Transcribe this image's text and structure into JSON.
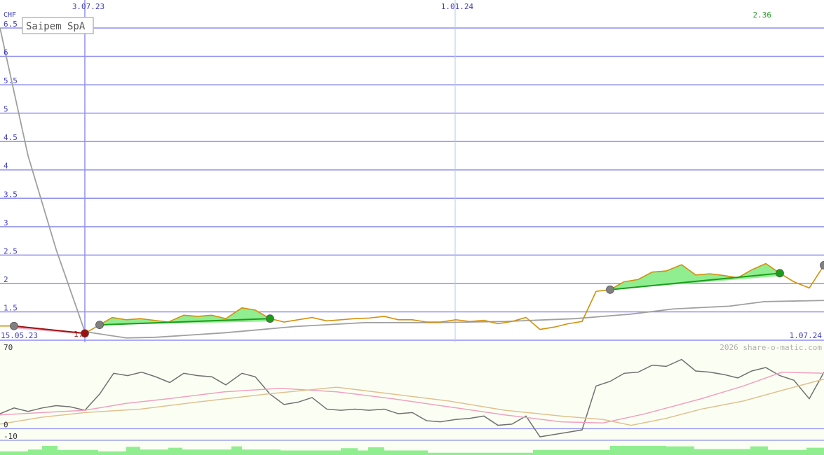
{
  "chart_data": {
    "type": "line",
    "title": "Saipem SpA",
    "ylabel": "CHF",
    "watermark": "2026 share-o-matic.com",
    "ylim": [
      1.0,
      6.5
    ],
    "y_ticks": [
      "6.5",
      "6",
      "5.5",
      "5",
      "4.5",
      "4",
      "3.5",
      "3",
      "2.5",
      "2",
      "1.5"
    ],
    "x_top_labels": [
      "3.07.23",
      "1.01.24"
    ],
    "x_corner_labels": {
      "start": "15.05.23",
      "end": "1.07.24"
    },
    "last_value_label": "2.36",
    "low_value_label": "1.",
    "indicator_ticks": [
      "70",
      "0",
      "-10"
    ],
    "indicator_ylim": [
      -10,
      70
    ],
    "colors": {
      "price": "#d4900a",
      "moving_avg": "#a0a0a0",
      "trend_up": "#1a9e1a",
      "trend_down": "#a01010",
      "fill_up": "#90ee90",
      "fill_down": "#f4b0c8",
      "grid": "#8f8ff0",
      "osc": "#707070",
      "osc_pink": "#f0a0c0",
      "osc_tan": "#e0c090"
    },
    "series": [
      {
        "key": "price",
        "values": [
          [
            0,
            1.25
          ],
          [
            20,
            1.25
          ],
          [
            121,
            1.12
          ],
          [
            142,
            1.27
          ],
          [
            160,
            1.4
          ],
          [
            180,
            1.36
          ],
          [
            200,
            1.38
          ],
          [
            220,
            1.35
          ],
          [
            240,
            1.32
          ],
          [
            262,
            1.44
          ],
          [
            282,
            1.42
          ],
          [
            302,
            1.44
          ],
          [
            322,
            1.38
          ],
          [
            345,
            1.57
          ],
          [
            364,
            1.53
          ],
          [
            385,
            1.38
          ],
          [
            405,
            1.32
          ],
          [
            425,
            1.36
          ],
          [
            445,
            1.4
          ],
          [
            466,
            1.34
          ],
          [
            486,
            1.36
          ],
          [
            506,
            1.38
          ],
          [
            526,
            1.39
          ],
          [
            548,
            1.42
          ],
          [
            568,
            1.36
          ],
          [
            588,
            1.36
          ],
          [
            608,
            1.32
          ],
          [
            628,
            1.32
          ],
          [
            650,
            1.36
          ],
          [
            670,
            1.33
          ],
          [
            690,
            1.35
          ],
          [
            710,
            1.29
          ],
          [
            730,
            1.33
          ],
          [
            750,
            1.4
          ],
          [
            770,
            1.19
          ],
          [
            790,
            1.23
          ],
          [
            810,
            1.29
          ],
          [
            830,
            1.33
          ],
          [
            850,
            1.86
          ],
          [
            870,
            1.89
          ],
          [
            890,
            2.03
          ],
          [
            910,
            2.07
          ],
          [
            930,
            2.2
          ],
          [
            950,
            2.22
          ],
          [
            972,
            2.33
          ],
          [
            992,
            2.15
          ],
          [
            1012,
            2.17
          ],
          [
            1032,
            2.14
          ],
          [
            1052,
            2.1
          ],
          [
            1072,
            2.24
          ],
          [
            1092,
            2.35
          ],
          [
            1112,
            2.18
          ],
          [
            1132,
            2.03
          ],
          [
            1154,
            1.92
          ],
          [
            1175,
            2.32
          ]
        ]
      },
      {
        "key": "moving_avg",
        "values": [
          [
            0,
            6.5
          ],
          [
            40,
            4.25
          ],
          [
            80,
            2.6
          ],
          [
            121,
            1.15
          ],
          [
            180,
            1.04
          ],
          [
            220,
            1.05
          ],
          [
            320,
            1.13
          ],
          [
            420,
            1.24
          ],
          [
            520,
            1.31
          ],
          [
            620,
            1.31
          ],
          [
            720,
            1.33
          ],
          [
            820,
            1.38
          ],
          [
            900,
            1.46
          ],
          [
            960,
            1.55
          ],
          [
            1040,
            1.6
          ],
          [
            1090,
            1.68
          ],
          [
            1175,
            1.7
          ]
        ]
      }
    ],
    "trend_segments": [
      {
        "direction": "down",
        "from": [
          20,
          1.25
        ],
        "to": [
          121,
          1.12
        ]
      },
      {
        "direction": "up",
        "from": [
          142,
          1.27
        ],
        "to": [
          385,
          1.38
        ]
      },
      {
        "direction": "up",
        "from": [
          870,
          1.89
        ],
        "to": [
          1112,
          2.18
        ]
      }
    ],
    "markers": [
      {
        "x": 20,
        "y": 1.25,
        "color": "#808080"
      },
      {
        "x": 121,
        "y": 1.12,
        "color": "#a01010"
      },
      {
        "x": 142,
        "y": 1.27,
        "color": "#808080"
      },
      {
        "x": 385,
        "y": 1.38,
        "color": "#1a9e1a"
      },
      {
        "x": 870,
        "y": 1.89,
        "color": "#808080"
      },
      {
        "x": 1112,
        "y": 2.18,
        "color": "#1a9e1a"
      },
      {
        "x": 1175,
        "y": 2.32,
        "color": "#808080"
      }
    ],
    "indicator_series": [
      {
        "key": "osc",
        "values": [
          [
            0,
            13
          ],
          [
            20,
            18
          ],
          [
            40,
            15
          ],
          [
            60,
            18
          ],
          [
            80,
            20
          ],
          [
            100,
            19
          ],
          [
            121,
            16
          ],
          [
            142,
            30
          ],
          [
            162,
            48
          ],
          [
            182,
            46
          ],
          [
            202,
            49
          ],
          [
            222,
            45
          ],
          [
            242,
            40
          ],
          [
            262,
            48
          ],
          [
            282,
            46
          ],
          [
            302,
            45
          ],
          [
            322,
            38
          ],
          [
            345,
            48
          ],
          [
            364,
            45
          ],
          [
            385,
            30
          ],
          [
            405,
            21
          ],
          [
            425,
            23
          ],
          [
            445,
            27
          ],
          [
            466,
            17
          ],
          [
            486,
            16
          ],
          [
            506,
            17
          ],
          [
            526,
            16
          ],
          [
            548,
            17
          ],
          [
            568,
            13
          ],
          [
            588,
            14
          ],
          [
            608,
            7
          ],
          [
            628,
            6
          ],
          [
            650,
            8
          ],
          [
            670,
            9
          ],
          [
            690,
            11
          ],
          [
            710,
            3
          ],
          [
            730,
            4
          ],
          [
            750,
            11
          ],
          [
            770,
            -7
          ],
          [
            790,
            -5
          ],
          [
            810,
            -3
          ],
          [
            830,
            -1
          ],
          [
            850,
            37
          ],
          [
            870,
            41
          ],
          [
            890,
            48
          ],
          [
            910,
            49
          ],
          [
            930,
            55
          ],
          [
            950,
            54
          ],
          [
            972,
            60
          ],
          [
            992,
            50
          ],
          [
            1012,
            49
          ],
          [
            1032,
            47
          ],
          [
            1052,
            44
          ],
          [
            1072,
            50
          ],
          [
            1092,
            53
          ],
          [
            1112,
            46
          ],
          [
            1132,
            42
          ],
          [
            1154,
            26
          ],
          [
            1175,
            49
          ]
        ]
      },
      {
        "key": "osc_pink",
        "values": [
          [
            0,
            12
          ],
          [
            60,
            14
          ],
          [
            121,
            16
          ],
          [
            180,
            22
          ],
          [
            240,
            26
          ],
          [
            320,
            32
          ],
          [
            400,
            35
          ],
          [
            480,
            32
          ],
          [
            560,
            26
          ],
          [
            640,
            19
          ],
          [
            720,
            12
          ],
          [
            800,
            6
          ],
          [
            860,
            5
          ],
          [
            920,
            13
          ],
          [
            1000,
            26
          ],
          [
            1060,
            37
          ],
          [
            1115,
            49
          ],
          [
            1175,
            48
          ]
        ]
      },
      {
        "key": "osc_tan",
        "values": [
          [
            0,
            4
          ],
          [
            60,
            10
          ],
          [
            121,
            14
          ],
          [
            200,
            17
          ],
          [
            280,
            23
          ],
          [
            380,
            30
          ],
          [
            480,
            36
          ],
          [
            560,
            30
          ],
          [
            640,
            24
          ],
          [
            720,
            16
          ],
          [
            800,
            11
          ],
          [
            860,
            8
          ],
          [
            900,
            3
          ],
          [
            950,
            9
          ],
          [
            1000,
            17
          ],
          [
            1060,
            24
          ],
          [
            1120,
            34
          ],
          [
            1175,
            43
          ]
        ]
      }
    ],
    "volume_bars": [
      {
        "x0": 0,
        "x1": 40,
        "level": 0.4
      },
      {
        "x0": 40,
        "x1": 60,
        "level": 0.6
      },
      {
        "x0": 60,
        "x1": 82,
        "level": 1.0
      },
      {
        "x0": 82,
        "x1": 140,
        "level": 0.55
      },
      {
        "x0": 140,
        "x1": 180,
        "level": 0.4
      },
      {
        "x0": 180,
        "x1": 200,
        "level": 0.9
      },
      {
        "x0": 200,
        "x1": 240,
        "level": 0.6
      },
      {
        "x0": 240,
        "x1": 260,
        "level": 0.8
      },
      {
        "x0": 260,
        "x1": 330,
        "level": 0.6
      },
      {
        "x0": 330,
        "x1": 345,
        "level": 0.95
      },
      {
        "x0": 345,
        "x1": 400,
        "level": 0.6
      },
      {
        "x0": 400,
        "x1": 470,
        "level": 0.5
      },
      {
        "x0": 470,
        "x1": 486,
        "level": 0.5
      },
      {
        "x0": 486,
        "x1": 510,
        "level": 0.75
      },
      {
        "x0": 510,
        "x1": 525,
        "level": 0.5
      },
      {
        "x0": 525,
        "x1": 548,
        "level": 0.85
      },
      {
        "x0": 548,
        "x1": 610,
        "level": 0.5
      },
      {
        "x0": 610,
        "x1": 760,
        "level": 0.25
      },
      {
        "x0": 760,
        "x1": 870,
        "level": 0.55
      },
      {
        "x0": 870,
        "x1": 950,
        "level": 1.0
      },
      {
        "x0": 950,
        "x1": 990,
        "level": 0.95
      },
      {
        "x0": 990,
        "x1": 1070,
        "level": 0.65
      },
      {
        "x0": 1070,
        "x1": 1095,
        "level": 0.95
      },
      {
        "x0": 1095,
        "x1": 1150,
        "level": 0.55
      },
      {
        "x0": 1150,
        "x1": 1175,
        "level": 0.8
      }
    ]
  }
}
